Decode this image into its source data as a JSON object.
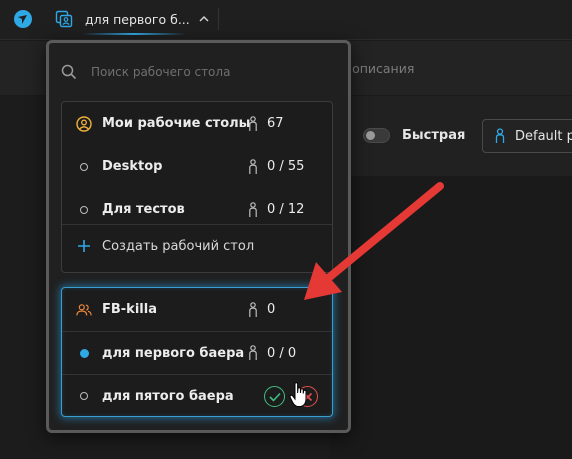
{
  "topbar": {
    "logo_icon": "app-logo-icon",
    "workspace_icon": "workspace-icon",
    "current_workspace": "для первого б...",
    "chevron_icon": "chevron-up-icon"
  },
  "subbar": {
    "description_fragment": "и, описания"
  },
  "toolbar": {
    "fast_label": "Быстрая",
    "default_profile_label": "Default p"
  },
  "dropdown": {
    "search": {
      "placeholder": "Поиск рабочего стола"
    },
    "my_workspaces": {
      "title": "Мои рабочие столы",
      "count": "67",
      "items": [
        {
          "name": "Desktop",
          "count": "0 / 55"
        },
        {
          "name": "Для тестов",
          "count": "0 / 12"
        }
      ],
      "create_label": "Создать рабочий стол"
    },
    "team": {
      "title": "FB-killa",
      "count": "0",
      "items": [
        {
          "name": "для первого баера",
          "count": "0 / 0",
          "active": true
        },
        {
          "name": "для пятого баера",
          "editing": true
        }
      ]
    }
  },
  "colors": {
    "accent": "#2fa8e6",
    "highlight_glow": "#3a9fd0",
    "confirm": "#3fbf7f",
    "cancel": "#e05050",
    "arrow": "#e53935",
    "user_icon": "#f0b23c",
    "team_icon": "#f08a3c"
  }
}
